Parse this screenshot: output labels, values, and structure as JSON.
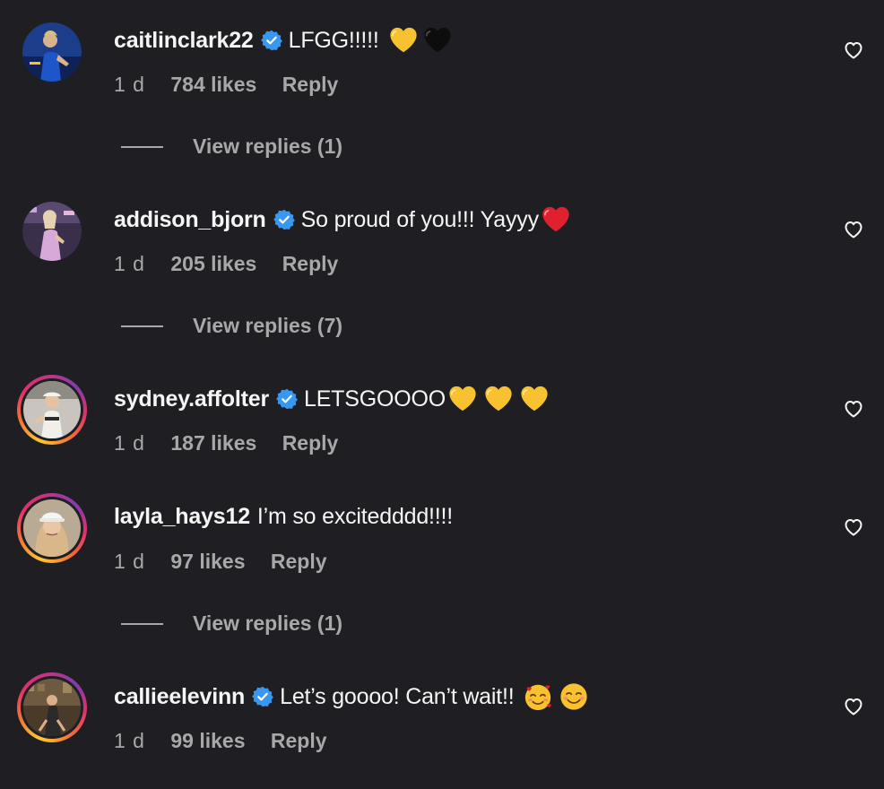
{
  "comments": [
    {
      "username": "caitlinclark22",
      "verified": true,
      "text": "LFGG!!!!!",
      "emojis": [
        "yellow-heart",
        "black-heart"
      ],
      "time": "1 d",
      "likes": "784 likes",
      "reply": "Reply",
      "view_replies": "View replies (1)"
    },
    {
      "username": "addison_bjorn",
      "verified": true,
      "text": "So proud of you!!! Yayyy",
      "emojis": [
        "red-heart"
      ],
      "time": "1 d",
      "likes": "205 likes",
      "reply": "Reply",
      "view_replies": "View replies (7)"
    },
    {
      "username": "sydney.affolter",
      "verified": true,
      "text": "LETSGOOOO",
      "emojis": [
        "yellow-heart",
        "yellow-heart",
        "yellow-heart"
      ],
      "time": "1 d",
      "likes": "187 likes",
      "reply": "Reply"
    },
    {
      "username": "layla_hays12",
      "verified": false,
      "text": "I’m so excitedddd!!!!",
      "time": "1 d",
      "likes": "97 likes",
      "reply": "Reply",
      "view_replies": "View replies (1)"
    },
    {
      "username": "callieelevinn",
      "verified": true,
      "text": "Let’s goooo! Can’t wait!!",
      "emojis": [
        "smiling-face-with-hearts",
        "smiling-face"
      ],
      "time": "1 d",
      "likes": "99 likes",
      "reply": "Reply"
    }
  ],
  "colors": {
    "background": "#1f1f23",
    "primary_text": "#f5f5f5",
    "secondary_text": "#a8a8a8",
    "verified_blue": "#3897f0",
    "yellow_heart": "#f8c12f",
    "red_heart": "#e0202e"
  }
}
